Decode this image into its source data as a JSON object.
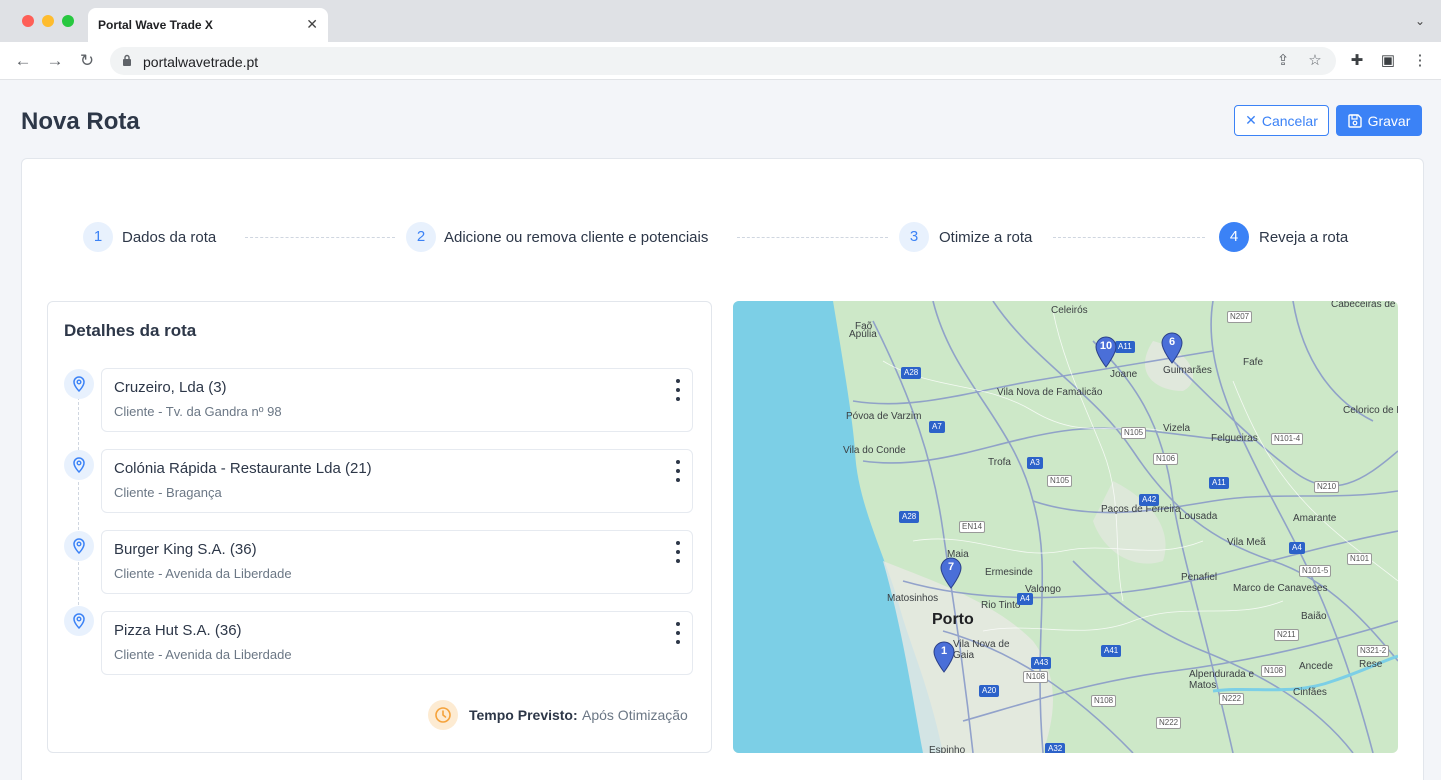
{
  "browser": {
    "tab_title": "Portal Wave Trade X",
    "url": "portalwavetrade.pt"
  },
  "page": {
    "title": "Nova Rota",
    "cancel_label": "Cancelar",
    "save_label": "Gravar"
  },
  "steps": [
    {
      "number": "1",
      "label": "Dados da rota",
      "active": false
    },
    {
      "number": "2",
      "label": "Adicione ou remova cliente e potenciais",
      "active": false
    },
    {
      "number": "3",
      "label": "Otimize a rota",
      "active": false
    },
    {
      "number": "4",
      "label": "Reveja a rota",
      "active": true
    }
  ],
  "details": {
    "title": "Detalhes da rota",
    "items": [
      {
        "name": "Cruzeiro, Lda (3)",
        "sub": "Cliente - Tv. da Gandra nº 98"
      },
      {
        "name": "Colónia Rápida - Restaurante Lda (21)",
        "sub": "Cliente - Bragança"
      },
      {
        "name": "Burger King S.A. (36)",
        "sub": "Cliente - Avenida da Liberdade"
      },
      {
        "name": "Pizza Hut S.A. (36)",
        "sub": "Cliente - Avenida da Liberdade"
      }
    ],
    "time_label": "Tempo Previsto:",
    "time_value": "Após Otimização"
  },
  "map": {
    "places": [
      "Celeirós",
      "Cabeceiras de Basto",
      "Faõ",
      "Apúlia",
      "Joane",
      "Guimarães",
      "Fafe",
      "Vila Nova de Famalicão",
      "Póvoa de Varzim",
      "Vila do Conde",
      "Vizela",
      "Felgueiras",
      "Celorico de Basto",
      "Trofa",
      "Paços de Ferreira",
      "Lousada",
      "Amarante",
      "Maia",
      "Ermesinde",
      "Valongo",
      "Vila Meã",
      "Penafiel",
      "Matosinhos",
      "Rio Tinto",
      "Marco de Canaveses",
      "Baião",
      "Vila Nova de Gaia",
      "Alpendurada e Matos",
      "Cinfães",
      "Ancede",
      "Rese",
      "Espinho"
    ],
    "city": "Porto",
    "roads": [
      "N207",
      "A11",
      "A28",
      "A7",
      "N105",
      "N106",
      "N101-4",
      "A3",
      "N105",
      "A11",
      "N210",
      "A42",
      "A28",
      "EN14",
      "A4",
      "N101",
      "N101-5",
      "A4",
      "N211",
      "N321-2",
      "A41",
      "A43",
      "N108",
      "N108",
      "A20",
      "N108",
      "N222",
      "N222",
      "A32"
    ],
    "markers": [
      "10",
      "6",
      "7",
      "1"
    ]
  }
}
